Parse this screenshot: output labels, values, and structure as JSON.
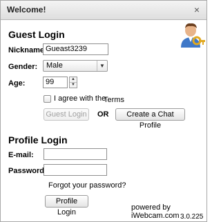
{
  "window": {
    "title": "Welcome!",
    "close_glyph": "×"
  },
  "guest": {
    "title": "Guest Login",
    "nickname_label": "Nickname:",
    "nickname_value": "Gueast3239",
    "gender_label": "Gender:",
    "gender_value": "Male",
    "age_label": "Age:",
    "age_value": "99",
    "agree_text": "I agree with the",
    "terms_text": "Terms",
    "guest_login_label": "Guest Login",
    "or_text": "OR",
    "create_profile_label": "Create a Chat Profile"
  },
  "profile": {
    "title": "Profile Login",
    "email_label": "E-mail:",
    "email_value": "",
    "password_label": "Password:",
    "password_value": "",
    "forgot_text": "Forgot your password?",
    "login_label": "Profile Login"
  },
  "footer": {
    "powered_by": "powered by iWebcam.com",
    "version": "3.0.225"
  },
  "icons": {
    "avatar": "user-key-icon",
    "close": "close-icon",
    "dropdown": "chevron-down-icon"
  }
}
